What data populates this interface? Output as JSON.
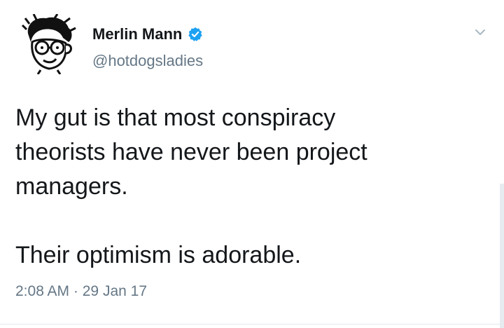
{
  "user": {
    "name": "Merlin Mann",
    "handle": "@hotdogsladies",
    "verified_color": "#1da1f2"
  },
  "tweet": {
    "lines": [
      "My gut is that most conspiracy",
      "theorists have never been project",
      "managers.",
      "Their optimism is adorable."
    ],
    "time": "2:08 AM",
    "separator": "·",
    "date": "29 Jan 17"
  },
  "icons": {
    "avatar": "cartoon-avatar",
    "verified": "verified-badge-icon",
    "menu": "chevron-down-icon"
  }
}
